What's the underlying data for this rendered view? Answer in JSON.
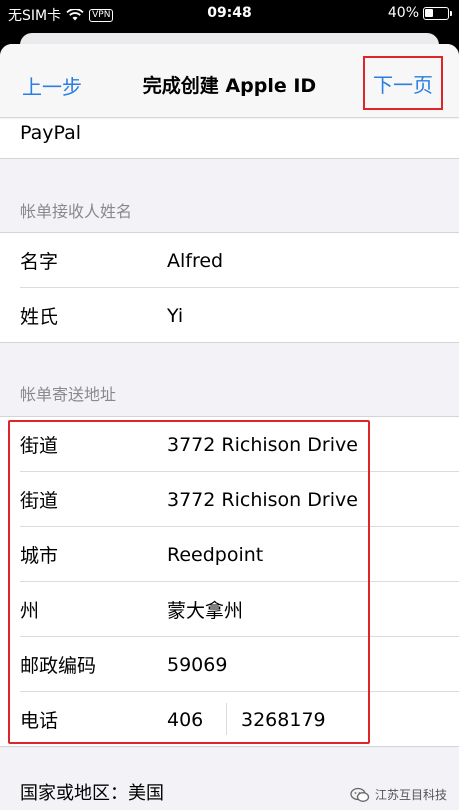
{
  "status_bar": {
    "carrier": "无SIM卡",
    "vpn": "VPN",
    "time": "09:48",
    "battery": "40%",
    "battery_level": 0.4
  },
  "nav": {
    "back_label": "上一步",
    "title": "完成创建 Apple ID",
    "next_label": "下一页"
  },
  "payment": {
    "method": "PayPal"
  },
  "billing_name": {
    "header": "帐单接收人姓名",
    "first_name_label": "名字",
    "first_name_value": "Alfred",
    "last_name_label": "姓氏",
    "last_name_value": "Yi"
  },
  "billing_address": {
    "header": "帐单寄送地址",
    "street1_label": "街道",
    "street1_value": "3772 Richison Drive",
    "street2_label": "街道",
    "street2_value": "3772 Richison Drive",
    "city_label": "城市",
    "city_value": "Reedpoint",
    "state_label": "州",
    "state_value": "蒙大拿州",
    "zip_label": "邮政编码",
    "zip_value": "59069",
    "phone_label": "电话",
    "phone_area": "406",
    "phone_number": "3268179"
  },
  "country": {
    "text": "国家或地区：美国"
  },
  "watermark": {
    "text": "江苏互目科技"
  },
  "colors": {
    "accent": "#2a7de1",
    "highlight": "#e0252a"
  }
}
